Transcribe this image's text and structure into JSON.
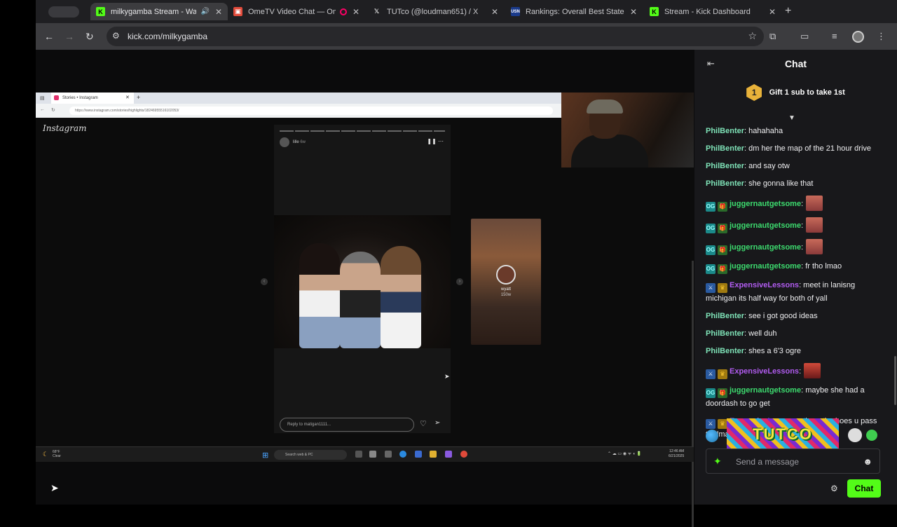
{
  "browser": {
    "tabs": [
      {
        "title": "milkygamba Stream - Wat",
        "favicon": "kick-icon",
        "color": "#53fc18",
        "active": true
      },
      {
        "title": "OmeTV Video Chat — Om",
        "favicon": "ometv-icon",
        "color": "#e24b3b",
        "active": false
      },
      {
        "title": "TUTco (@loudman651) / X",
        "favicon": "x-icon",
        "color": "#000000",
        "active": false
      },
      {
        "title": "Rankings: Overall Best States",
        "favicon": "usnews-icon",
        "color": "#1a3a8a",
        "active": false
      },
      {
        "title": "Stream - Kick Dashboard",
        "favicon": "kick-icon",
        "color": "#53fc18",
        "active": false
      }
    ],
    "url": "kick.com/milkygamba"
  },
  "stream": {
    "instagram": {
      "tab_title": "Stories • Instagram",
      "url": "https://www.instagram.com/stories/highlights/18246955516102053/",
      "logo": "Instagram",
      "story_user": "lille",
      "story_time": "6w",
      "reply_placeholder": "Reply to matigan1111...",
      "next_user": "wyatt",
      "next_time": "150w"
    },
    "taskbar": {
      "weather_temp": "68°F",
      "weather_desc": "Clear",
      "search_placeholder": "Search web & PC",
      "time": "12:46 AM",
      "date": "6/21/2025"
    }
  },
  "chat": {
    "title": "Chat",
    "gift_rank": "1",
    "gift_text": "Gift 1 sub to take 1st",
    "messages": [
      {
        "user": "PhilBenter",
        "color": "#7fe3b8",
        "text": ": hahahaha",
        "badges": []
      },
      {
        "user": "PhilBenter",
        "color": "#7fe3b8",
        "text": ": dm her the map of the 21 hour drive",
        "badges": []
      },
      {
        "user": "PhilBenter",
        "color": "#7fe3b8",
        "text": ": and say otw",
        "badges": []
      },
      {
        "user": "PhilBenter",
        "color": "#7fe3b8",
        "text": ": she gonna like that",
        "badges": []
      },
      {
        "user": "juggernautgetsome",
        "color": "#3ddc6f",
        "text": ":",
        "badges": [
          "og",
          "gift"
        ],
        "emote": true
      },
      {
        "user": "juggernautgetsome",
        "color": "#3ddc6f",
        "text": ":",
        "badges": [
          "og",
          "gift"
        ],
        "emote": true
      },
      {
        "user": "juggernautgetsome",
        "color": "#3ddc6f",
        "text": ":",
        "badges": [
          "og",
          "gift"
        ],
        "emote": true
      },
      {
        "user": "juggernautgetsome",
        "color": "#3ddc6f",
        "text": ": fr tho lmao",
        "badges": [
          "og",
          "gift"
        ]
      },
      {
        "user": "ExpensiveLessons",
        "color": "#b15cf0",
        "text": ": meet in lanisng michigan its half way for both of yall",
        "badges": [
          "mod",
          "crown"
        ]
      },
      {
        "user": "PhilBenter",
        "color": "#7fe3b8",
        "text": ": see i got good ideas",
        "badges": []
      },
      {
        "user": "PhilBenter",
        "color": "#7fe3b8",
        "text": ": well duh",
        "badges": []
      },
      {
        "user": "PhilBenter",
        "color": "#7fe3b8",
        "text": ": shes a 6'3 ogre",
        "badges": []
      },
      {
        "user": "ExpensiveLessons",
        "color": "#b15cf0",
        "text": ":",
        "badges": [
          "mod",
          "crown"
        ],
        "emote": true
      },
      {
        "user": "juggernautgetsome",
        "color": "#3ddc6f",
        "text": ": maybe she had a doordash to go get",
        "badges": [
          "og",
          "gift"
        ]
      },
      {
        "user": "ExpensiveLessons",
        "color": "#b15cf0",
        "text": ": them the hoes u pass to dman and daymon fuck it",
        "badges": [
          "mod",
          "crown"
        ]
      }
    ],
    "banner_emote": "TUTCO",
    "send_placeholder": "Send a message",
    "send_button": "Chat",
    "accent": "#53fc18"
  }
}
